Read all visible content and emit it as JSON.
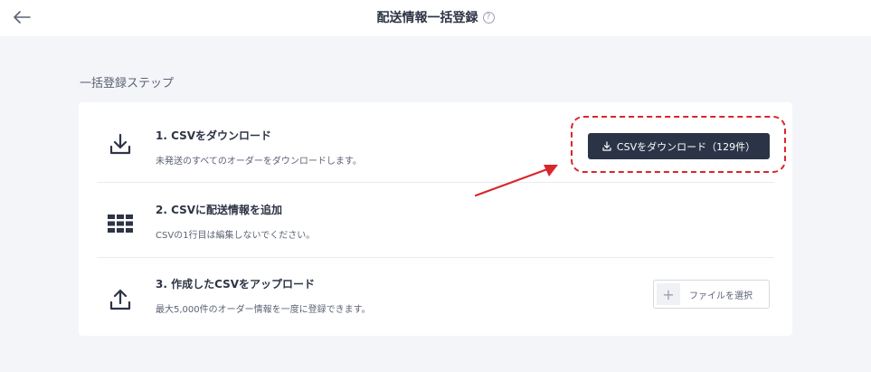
{
  "header": {
    "title": "配送情報一括登録",
    "help": "?",
    "icons": {
      "back": "arrow-left-icon",
      "help": "question-circle-icon"
    }
  },
  "section": {
    "heading": "一括登録ステップ"
  },
  "steps": [
    {
      "title": "1. CSVをダウンロード",
      "description": "未発送のすべてのオーダーをダウンロードします。",
      "icon": "download-icon",
      "button_label": "CSVをダウンロード（129件）"
    },
    {
      "title": "2. CSVに配送情報を追加",
      "description": "CSVの1行目は編集しないでください。",
      "icon": "grid-table-icon"
    },
    {
      "title": "3. 作成したCSVをアップロード",
      "description": "最大5,000件のオーダー情報を一度に登録できます。",
      "icon": "upload-icon",
      "button_plus": "+",
      "button_label": "ファイルを選択"
    }
  ],
  "colors": {
    "primary_button": "#2b3447",
    "annotation": "#d9262c",
    "background": "#f4f5f8"
  }
}
